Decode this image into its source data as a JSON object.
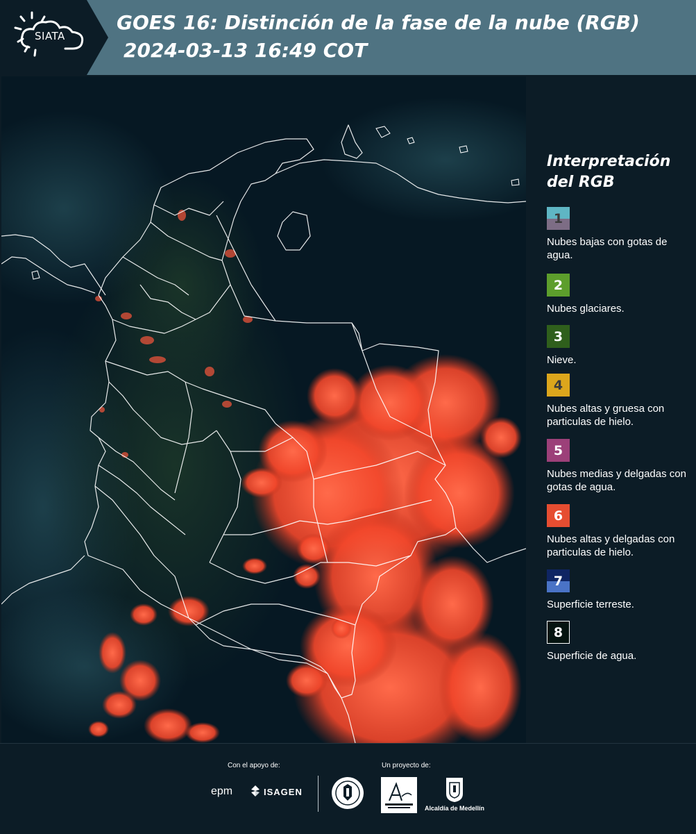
{
  "header": {
    "logo_text": "SIATA",
    "title": "GOES 16: Distinción de la fase de la nube (RGB)",
    "datetime": "2024-03-13 16:49 COT"
  },
  "legend": {
    "title_line1": "Interpretación",
    "title_line2": "del RGB",
    "items": [
      {
        "number": "1",
        "label": "Nubes bajas con gotas de agua.",
        "color_top": "#5fb6c4",
        "color_bottom": "#7d6d85",
        "text_color": "#3b3b3b"
      },
      {
        "number": "2",
        "label": "Nubes glaciares.",
        "color_top": "#5d9e2c",
        "color_bottom": "#5d9e2c",
        "text_color": "#ffffff"
      },
      {
        "number": "3",
        "label": "Nieve.",
        "color_top": "#2f5f1c",
        "color_bottom": "#2f5f1c",
        "text_color": "#ffffff"
      },
      {
        "number": "4",
        "label": "Nubes altas y gruesa con particulas de hielo.",
        "color_top": "#dca61c",
        "color_bottom": "#dca61c",
        "text_color": "#3b3b3b"
      },
      {
        "number": "5",
        "label": "Nubes medias y delgadas con gotas de agua.",
        "color_top": "#9c4079",
        "color_bottom": "#9c4079",
        "text_color": "#ffffff"
      },
      {
        "number": "6",
        "label": "Nubes altas y delgadas con particulas de hielo.",
        "color_top": "#e64d31",
        "color_bottom": "#e64d31",
        "text_color": "#ffffff"
      },
      {
        "number": "7",
        "label": "Superficie terreste.",
        "color_top": "#0f2563",
        "color_bottom": "#4a73c6",
        "text_color": "#ffffff"
      },
      {
        "number": "8",
        "label": "Superficie de agua.",
        "color_top": "#061410",
        "color_bottom": "#061410",
        "text_color": "#ffffff"
      }
    ]
  },
  "footer": {
    "support_label": "Con el apoyo de:",
    "project_label": "Un proyecto de:",
    "sponsor1": "epm",
    "sponsor2": "ISAGEN",
    "partner_area": "Área Metropolitana",
    "partner_alcaldia": "Alcaldía de Medellín"
  },
  "colors": {
    "header_bg": "#4f7382",
    "logo_bg": "#0c1c26",
    "page_bg": "#0c1c26",
    "cloud_red": "#ff5a3c",
    "border_white": "#ffffff"
  }
}
